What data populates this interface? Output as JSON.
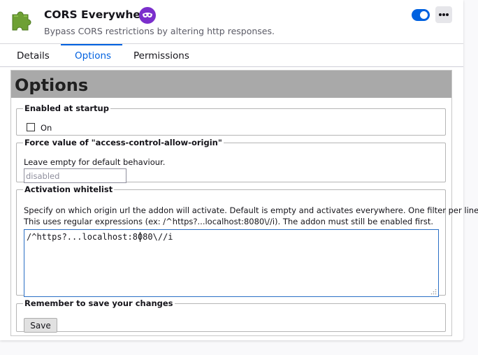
{
  "header": {
    "addon_name": "CORS Everywhere",
    "description": "Bypass CORS restrictions by altering http responses.",
    "icon": "puzzle-piece-icon",
    "badge_icon": "recommended-mask-icon",
    "toggle_enabled": true,
    "more_icon": "three-dots-icon"
  },
  "tabs": [
    {
      "label": "Details",
      "active": false
    },
    {
      "label": "Options",
      "active": true
    },
    {
      "label": "Permissions",
      "active": false
    }
  ],
  "options": {
    "title": "Options",
    "startup": {
      "legend": "Enabled at startup",
      "checkbox_label": "On",
      "checked": false
    },
    "force_value": {
      "legend": "Force value of \"access-control-allow-origin\"",
      "hint": "Leave empty for default behaviour.",
      "placeholder": "disabled",
      "value": ""
    },
    "whitelist": {
      "legend": "Activation whitelist",
      "description_line1": "Specify on which origin url the addon will activate. Default is empty and activates everywhere. One filter per line.",
      "description_line2": "This uses regular expressions (ex: /^https?...localhost:8080\\//i). The addon must still be enabled first.",
      "value": "/^https?...localhost:8080\\//i"
    },
    "save": {
      "legend": "Remember to save your changes",
      "button_label": "Save"
    }
  },
  "colors": {
    "accent": "#0061e0",
    "banner": "#a9a9a9",
    "badge": "#7b2fcc"
  }
}
